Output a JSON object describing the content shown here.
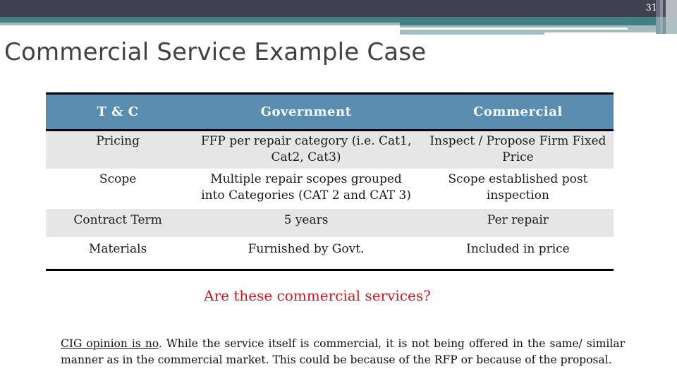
{
  "slide": {
    "number": "31",
    "title": "Commercial Service Example Case"
  },
  "table": {
    "headers": [
      "T & C",
      "Government",
      "Commercial"
    ],
    "rows": [
      {
        "term": "Pricing",
        "government": "FFP per repair category (i.e. Cat1, Cat2, Cat3)",
        "commercial": "Inspect / Propose Firm Fixed Price"
      },
      {
        "term": "Scope",
        "government": "Multiple repair scopes grouped into Categories (CAT 2 and CAT 3)",
        "commercial": "Scope established post inspection"
      },
      {
        "term": "Contract Term",
        "government": "5 years",
        "commercial": "Per repair"
      },
      {
        "term": "Materials",
        "government": "Furnished by Govt.",
        "commercial": "Included in price"
      }
    ]
  },
  "question": "Are these commercial services?",
  "opinion": {
    "underlined": "CIG opinion is no",
    "rest": ". While the service itself is commercial, it is not being offered in the same/ similar manner as in the commercial market. This could be because of the RFP or because of the proposal."
  },
  "colors": {
    "header_dark": "#414152",
    "header_teal": "#457f84",
    "header_light": "#a3bcbf",
    "table_header": "#5b8db0",
    "row_shade": "#e6e6e6",
    "question_red": "#c0191f"
  }
}
